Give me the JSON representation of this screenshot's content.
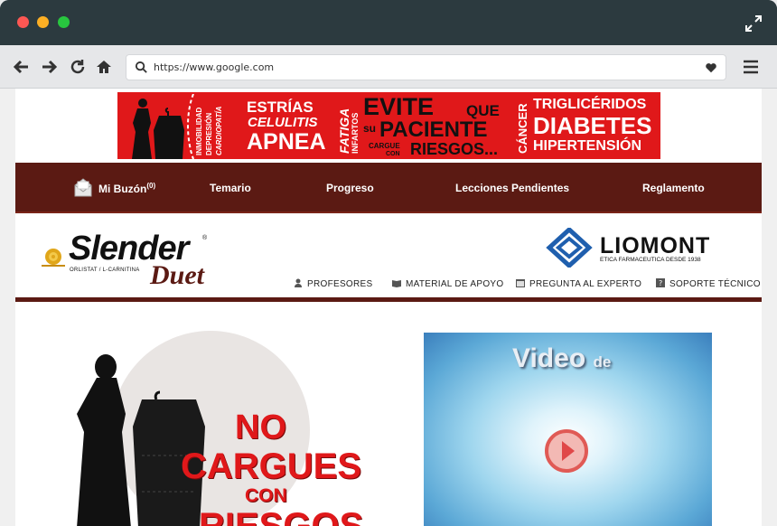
{
  "browser": {
    "url": "https://www.google.com",
    "icons": [
      "back-arrow-icon",
      "forward-arrow-icon",
      "reload-icon",
      "home-icon",
      "search-icon",
      "heart-icon",
      "hamburger-menu-icon",
      "expand-icon"
    ]
  },
  "banner": {
    "left_col": [
      "INMOBILIDAD",
      "DEPRESIÓN",
      "CARDIOPATÍA"
    ],
    "estrias": "ESTRÍAS",
    "celulitis": "CELULITIS",
    "apnea": "APNEA",
    "fatiga": "FATIGA",
    "infartos": "INFARTOS",
    "evite": "EVITE",
    "que": "QUE",
    "su": "su",
    "paciente": "PACIENTE",
    "cargue": "CARGUE",
    "con": "CON",
    "riesgos": "RIESGOS...",
    "cancer": "CÁNCER",
    "trigliceridos": "TRIGLICÉRIDOS",
    "diabetes": "DIABETES",
    "hipertension": "HIPERTENSIÓN"
  },
  "nav": {
    "mailbox": "Mi Buzón",
    "mailbox_count": "(0)",
    "temario": "Temario",
    "progreso": "Progreso",
    "lecciones": "Lecciones Pendientes",
    "reglamento": "Reglamento"
  },
  "header": {
    "slender": "Slender",
    "reg": "®",
    "slender_sub": "ORLISTAT / L-CARNITINA",
    "duet": "Duet",
    "liomont": "LIOMONT",
    "liomont_tag": "ETICA FARMACEUTICA DESDE 1938",
    "links": {
      "profesores": "PROFESORES",
      "material": "MATERIAL DE APOYO",
      "pregunta": "PREGUNTA AL EXPERTO",
      "soporte": "SOPORTE TÉCNICO"
    }
  },
  "hero": {
    "line1": "NO",
    "line2": "CARGUES",
    "line3": "CON",
    "line4": "RIESGOS"
  },
  "video": {
    "title": "Video",
    "title_small": "de"
  },
  "colors": {
    "brand_maroon": "#5b1a13",
    "banner_red": "#e0181a",
    "liomont_blue": "#1f5fae"
  }
}
